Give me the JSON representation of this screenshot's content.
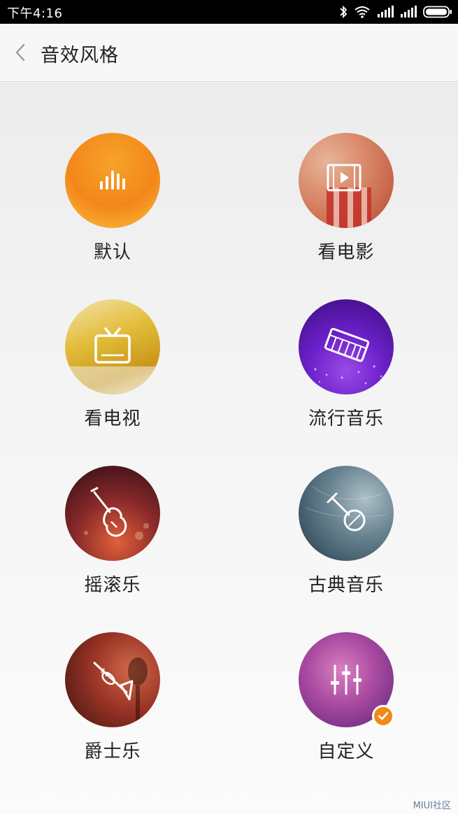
{
  "status_bar": {
    "time": "下午4:16",
    "icons": [
      "bluetooth-icon",
      "wifi-icon",
      "signal-icon",
      "signal-icon",
      "battery-icon"
    ]
  },
  "header": {
    "back_icon": "chevron-left-icon",
    "title": "音效风格"
  },
  "styles": [
    {
      "id": "default",
      "label": "默认",
      "icon": "sound-bars-icon",
      "colors": [
        "#f3861a",
        "#fbbf3c"
      ],
      "selected": false
    },
    {
      "id": "movie",
      "label": "看电影",
      "icon": "film-play-icon",
      "colors": [
        "#c94a3a",
        "#e6a78c"
      ],
      "selected": false
    },
    {
      "id": "tv",
      "label": "看电视",
      "icon": "tv-icon",
      "colors": [
        "#d9a820",
        "#f2d77a"
      ],
      "selected": false
    },
    {
      "id": "pop",
      "label": "流行音乐",
      "icon": "keyboard-icon",
      "colors": [
        "#3a0d7a",
        "#8a2fd8"
      ],
      "selected": false
    },
    {
      "id": "rock",
      "label": "摇滚乐",
      "icon": "electric-guitar-icon",
      "colors": [
        "#3a1018",
        "#d8553a"
      ],
      "selected": false
    },
    {
      "id": "classical",
      "label": "古典音乐",
      "icon": "pipa-icon",
      "colors": [
        "#223a4a",
        "#8aa3b0"
      ],
      "selected": false
    },
    {
      "id": "jazz",
      "label": "爵士乐",
      "icon": "trumpet-icon",
      "colors": [
        "#4a1a14",
        "#c0523a"
      ],
      "selected": false
    },
    {
      "id": "custom",
      "label": "自定义",
      "icon": "equalizer-icon",
      "colors": [
        "#6a2a8a",
        "#d06ab0"
      ],
      "selected": true
    }
  ],
  "selected_badge_icon": "check-icon",
  "watermark": "MIUI社区"
}
